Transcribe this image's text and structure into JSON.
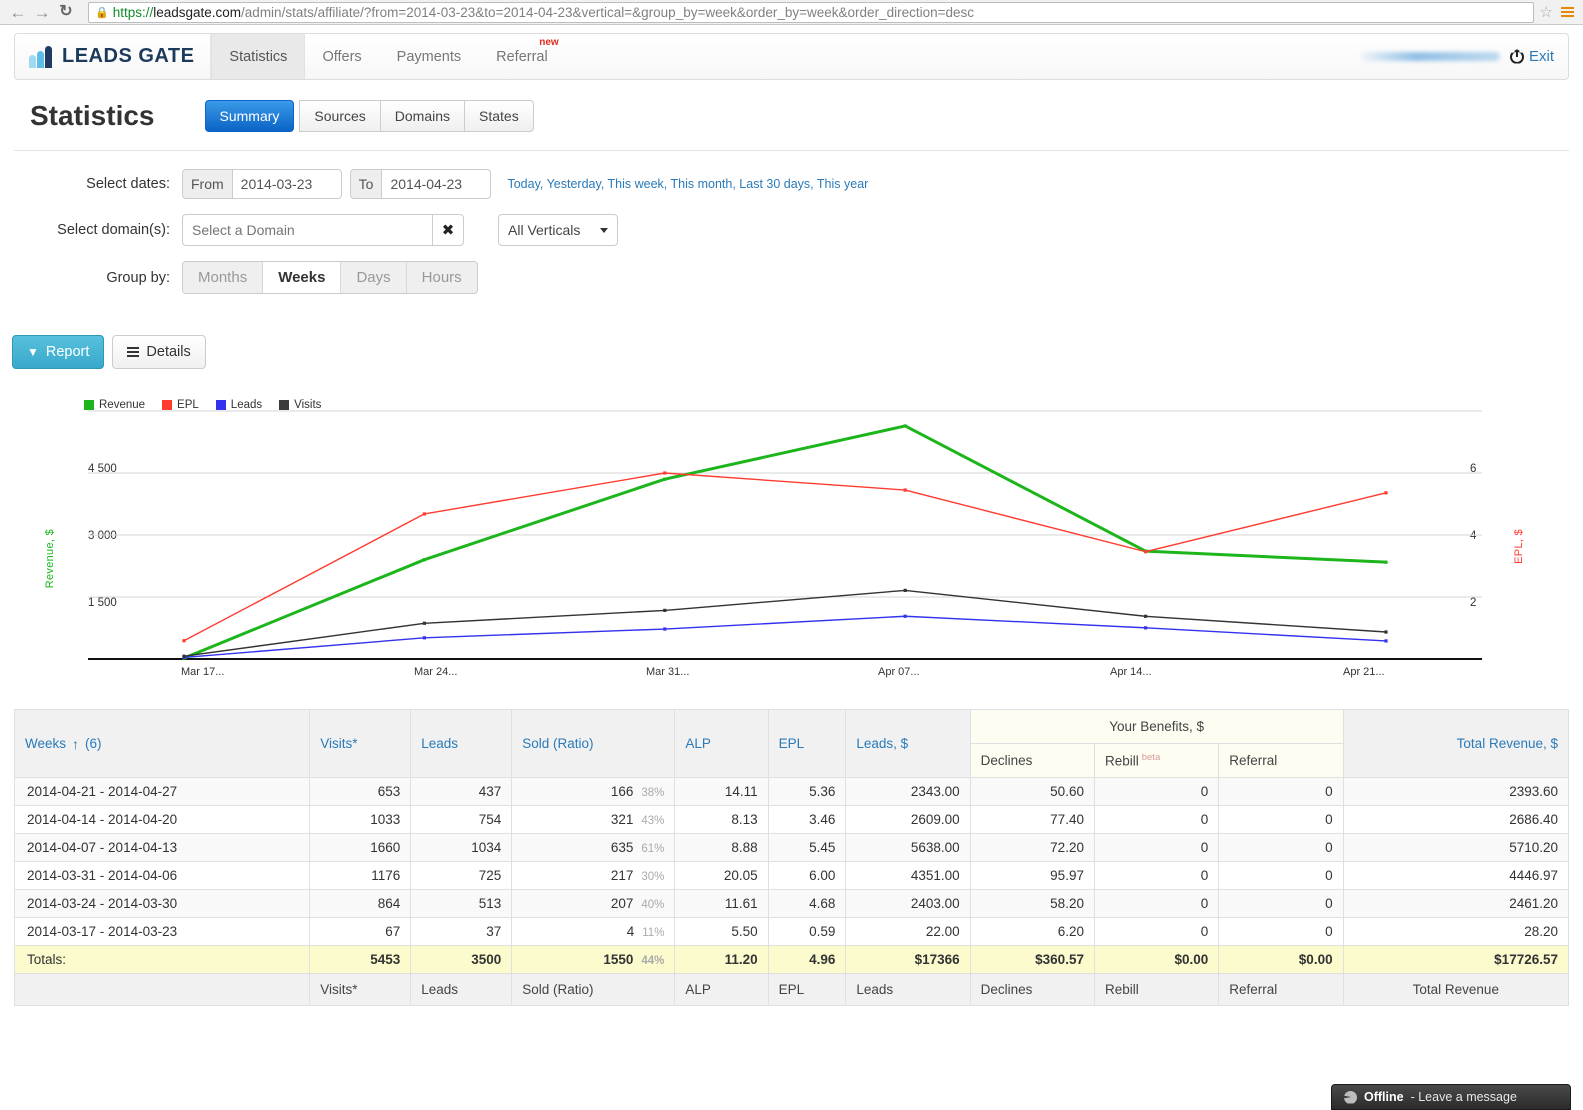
{
  "browser": {
    "back_icon": "back-arrow-icon",
    "forward_icon": "forward-arrow-icon",
    "reload_icon": "reload-icon",
    "lock_icon": "lock-icon",
    "url_protocol": "https://",
    "url_host": "leadsgate.com",
    "url_path": "/admin/stats/affiliate/?from=2014-03-23&to=2014-04-23&vertical=&group_by=week&order_by=week&order_direction=desc",
    "star_icon": "bookmark-star-icon",
    "menu_icon": "chrome-menu-icon"
  },
  "topnav": {
    "logo_text": "LEADS GATE",
    "items": [
      {
        "label": "Statistics",
        "active": true
      },
      {
        "label": "Offers",
        "active": false
      },
      {
        "label": "Payments",
        "active": false
      },
      {
        "label": "Referral",
        "active": false,
        "badge": "new"
      }
    ],
    "exit_label": "Exit",
    "exit_icon": "power-icon"
  },
  "page": {
    "title": "Statistics",
    "tabs": [
      {
        "label": "Summary",
        "active": true
      },
      {
        "label": "Sources",
        "active": false
      },
      {
        "label": "Domains",
        "active": false
      },
      {
        "label": "States",
        "active": false
      }
    ]
  },
  "filters": {
    "dates_label": "Select dates:",
    "from_addon": "From",
    "from_value": "2014-03-23",
    "to_addon": "To",
    "to_value": "2014-04-23",
    "quick_ranges": "Today,  Yesterday,  This week,  This month,  Last 30 days,  This year",
    "domain_label": "Select domain(s):",
    "domain_placeholder": "Select a Domain",
    "domain_value": "",
    "domain_clear_icon": "clear-x-icon",
    "vertical_value": "All Verticals",
    "groupby_label": "Group by:",
    "groupby_options": [
      {
        "label": "Months",
        "active": false
      },
      {
        "label": "Weeks",
        "active": true
      },
      {
        "label": "Days",
        "active": false
      },
      {
        "label": "Hours",
        "active": false
      }
    ]
  },
  "actions": {
    "report_label": "Report",
    "report_icon": "funnel-icon",
    "details_label": "Details",
    "details_icon": "list-icon"
  },
  "chart_data": {
    "type": "line",
    "title": "",
    "x": [
      "Mar 17...",
      "Mar 24...",
      "Mar 31...",
      "Apr 07...",
      "Apr 14...",
      "Apr 21..."
    ],
    "xlabel": "",
    "ylabel": "Revenue, $",
    "y2label": "EPL, $",
    "ylim": [
      0,
      6000
    ],
    "yticks": [
      1500,
      3000,
      4500
    ],
    "ytick_labels": [
      "1 500",
      "3 000",
      "4 500"
    ],
    "y2lim": [
      0,
      8
    ],
    "y2ticks": [
      2,
      4,
      6
    ],
    "y2tick_labels": [
      "2",
      "4",
      "6"
    ],
    "grid": true,
    "legend_position": "top-left",
    "series": [
      {
        "name": "Revenue",
        "color": "#1cb61c",
        "axis": "left",
        "values": [
          22,
          2403,
          4351,
          5638,
          2609,
          2343
        ]
      },
      {
        "name": "EPL",
        "color": "#ff3b30",
        "axis": "right",
        "values": [
          0.59,
          4.68,
          6.0,
          5.45,
          3.46,
          5.36
        ]
      },
      {
        "name": "Leads",
        "color": "#3333ee",
        "axis": "left",
        "values": [
          37,
          513,
          725,
          1034,
          754,
          437
        ]
      },
      {
        "name": "Visits",
        "color": "#333333",
        "axis": "left",
        "values": [
          67,
          864,
          1176,
          1660,
          1033,
          653
        ]
      }
    ]
  },
  "table": {
    "lead_header": "Weeks",
    "sort_arrow": "↑",
    "row_count": "(6)",
    "benefits_group": "Your Benefits, $",
    "headers": {
      "visits": "Visits*",
      "leads": "Leads",
      "sold": "Sold (Ratio)",
      "alp": "ALP",
      "epl": "EPL",
      "leads_money": "Leads, $",
      "declines": "Declines",
      "rebill": "Rebill",
      "rebill_beta": "beta",
      "referral": "Referral",
      "total_revenue": "Total Revenue, $"
    },
    "footer": {
      "visits": "Visits*",
      "leads": "Leads",
      "sold": "Sold (Ratio)",
      "alp": "ALP",
      "epl": "EPL",
      "leads_money": "Leads",
      "declines": "Declines",
      "rebill": "Rebill",
      "referral": "Referral",
      "total_revenue": "Total Revenue"
    },
    "rows": [
      {
        "week": "2014-04-21 - 2014-04-27",
        "visits": "653",
        "leads": "437",
        "sold": "166",
        "ratio": "38%",
        "alp": "14.11",
        "epl": "5.36",
        "leads_money": "2343.00",
        "declines": "50.60",
        "rebill": "0",
        "referral": "0",
        "total": "2393.60"
      },
      {
        "week": "2014-04-14 - 2014-04-20",
        "visits": "1033",
        "leads": "754",
        "sold": "321",
        "ratio": "43%",
        "alp": "8.13",
        "epl": "3.46",
        "leads_money": "2609.00",
        "declines": "77.40",
        "rebill": "0",
        "referral": "0",
        "total": "2686.40"
      },
      {
        "week": "2014-04-07 - 2014-04-13",
        "visits": "1660",
        "leads": "1034",
        "sold": "635",
        "ratio": "61%",
        "alp": "8.88",
        "epl": "5.45",
        "leads_money": "5638.00",
        "declines": "72.20",
        "rebill": "0",
        "referral": "0",
        "total": "5710.20"
      },
      {
        "week": "2014-03-31 - 2014-04-06",
        "visits": "1176",
        "leads": "725",
        "sold": "217",
        "ratio": "30%",
        "alp": "20.05",
        "epl": "6.00",
        "leads_money": "4351.00",
        "declines": "95.97",
        "rebill": "0",
        "referral": "0",
        "total": "4446.97"
      },
      {
        "week": "2014-03-24 - 2014-03-30",
        "visits": "864",
        "leads": "513",
        "sold": "207",
        "ratio": "40%",
        "alp": "11.61",
        "epl": "4.68",
        "leads_money": "2403.00",
        "declines": "58.20",
        "rebill": "0",
        "referral": "0",
        "total": "2461.20"
      },
      {
        "week": "2014-03-17 - 2014-03-23",
        "visits": "67",
        "leads": "37",
        "sold": "4",
        "ratio": "11%",
        "alp": "5.50",
        "epl": "0.59",
        "leads_money": "22.00",
        "declines": "6.20",
        "rebill": "0",
        "referral": "0",
        "total": "28.20"
      }
    ],
    "totals": {
      "week": "Totals:",
      "visits": "5453",
      "leads": "3500",
      "sold": "1550",
      "ratio": "44%",
      "alp": "11.20",
      "epl": "4.96",
      "leads_money": "$17366",
      "declines": "$360.57",
      "rebill": "$0.00",
      "referral": "$0.00",
      "total": "$17726.57"
    }
  },
  "chat": {
    "status": "Offline",
    "separator": " - ",
    "message": "Leave a message",
    "icon": "chat-status-icon"
  }
}
